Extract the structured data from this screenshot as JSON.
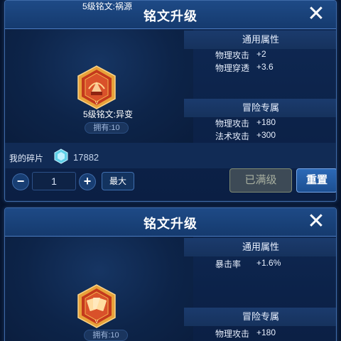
{
  "panel1": {
    "title": "铭文升级",
    "item_name": "5级铭文:异变",
    "owned": "拥有:10",
    "general_header": "通用属性",
    "general_stats": [
      {
        "k": "物理攻击",
        "v": "+2"
      },
      {
        "k": "物理穿透",
        "v": "+3.6"
      }
    ],
    "adventure_header": "冒险专属",
    "adventure_stats": [
      {
        "k": "物理攻击",
        "v": "+180"
      },
      {
        "k": "法术攻击",
        "v": "+300"
      }
    ],
    "shards_label": "我的碎片",
    "shards_count": "17882",
    "qty_value": "1",
    "minus": "−",
    "plus": "+",
    "max_label": "最大",
    "maxed_label": "已满级",
    "reset_label": "重置",
    "close_glyph": "✕"
  },
  "panel2": {
    "title": "铭文升级",
    "item_name": "5级铭文:祸源",
    "owned": "拥有:10",
    "general_header": "通用属性",
    "general_stats": [
      {
        "k": "暴击率",
        "v": "+1.6%"
      }
    ],
    "adventure_header": "冒险专属",
    "adventure_stats": [
      {
        "k": "物理攻击",
        "v": "+180"
      }
    ],
    "close_glyph": "✕"
  },
  "colors": {
    "panel_bg": "#0c2249",
    "border": "#3e6aa8",
    "emblem_red": "#c4391c",
    "emblem_gold": "#e8a23a",
    "reset_blue": "#2c69b7"
  },
  "icons": [
    "close-icon",
    "rune-emblem-icon",
    "shard-crystal-icon",
    "minus-icon",
    "plus-icon"
  ]
}
